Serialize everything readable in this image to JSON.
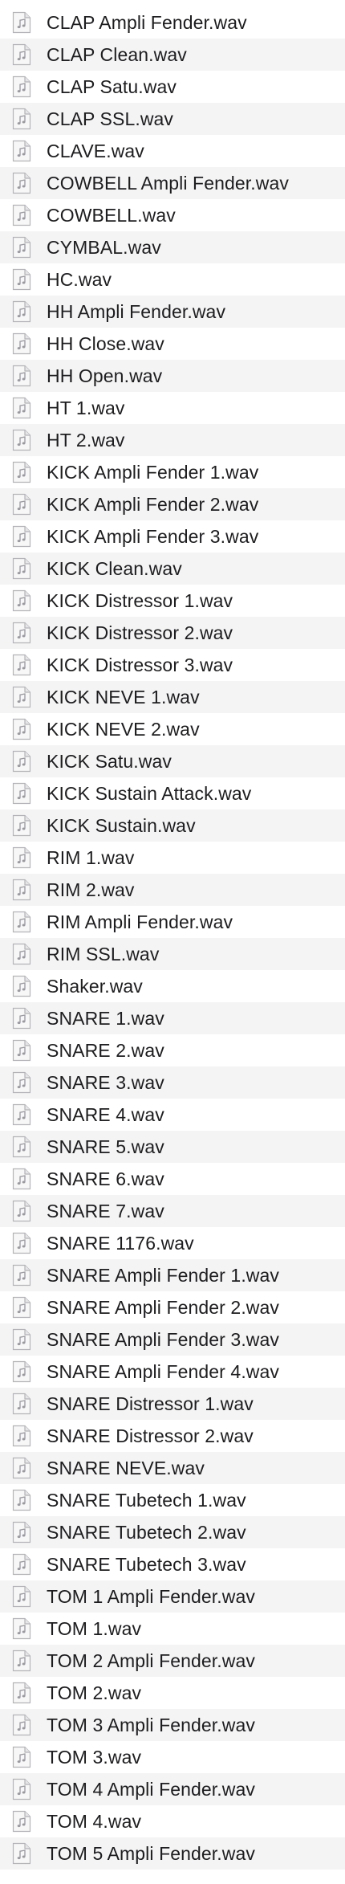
{
  "file_list": {
    "icon": "audio-file-icon",
    "items": [
      "CLAP Ampli Fender.wav",
      "CLAP Clean.wav",
      "CLAP Satu.wav",
      "CLAP SSL.wav",
      "CLAVE.wav",
      "COWBELL Ampli Fender.wav",
      "COWBELL.wav",
      "CYMBAL.wav",
      "HC.wav",
      "HH Ampli Fender.wav",
      "HH Close.wav",
      "HH Open.wav",
      "HT 1.wav",
      "HT 2.wav",
      "KICK Ampli Fender 1.wav",
      "KICK Ampli Fender 2.wav",
      "KICK Ampli Fender 3.wav",
      "KICK Clean.wav",
      "KICK Distressor 1.wav",
      "KICK Distressor 2.wav",
      "KICK Distressor 3.wav",
      "KICK NEVE 1.wav",
      "KICK NEVE 2.wav",
      "KICK Satu.wav",
      "KICK Sustain Attack.wav",
      "KICK Sustain.wav",
      "RIM 1.wav",
      "RIM 2.wav",
      "RIM Ampli Fender.wav",
      "RIM SSL.wav",
      "Shaker.wav",
      "SNARE 1.wav",
      "SNARE 2.wav",
      "SNARE 3.wav",
      "SNARE 4.wav",
      "SNARE 5.wav",
      "SNARE 6.wav",
      "SNARE 7.wav",
      "SNARE 1176.wav",
      "SNARE Ampli Fender 1.wav",
      "SNARE Ampli Fender 2.wav",
      "SNARE Ampli Fender 3.wav",
      "SNARE Ampli Fender 4.wav",
      "SNARE Distressor 1.wav",
      "SNARE Distressor 2.wav",
      "SNARE NEVE.wav",
      "SNARE Tubetech 1.wav",
      "SNARE Tubetech 2.wav",
      "SNARE Tubetech 3.wav",
      "TOM 1 Ampli Fender.wav",
      "TOM 1.wav",
      "TOM 2 Ampli Fender.wav",
      "TOM 2.wav",
      "TOM 3 Ampli Fender.wav",
      "TOM 3.wav",
      "TOM 4 Ampli Fender.wav",
      "TOM 4.wav",
      "TOM 5 Ampli Fender.wav"
    ]
  }
}
